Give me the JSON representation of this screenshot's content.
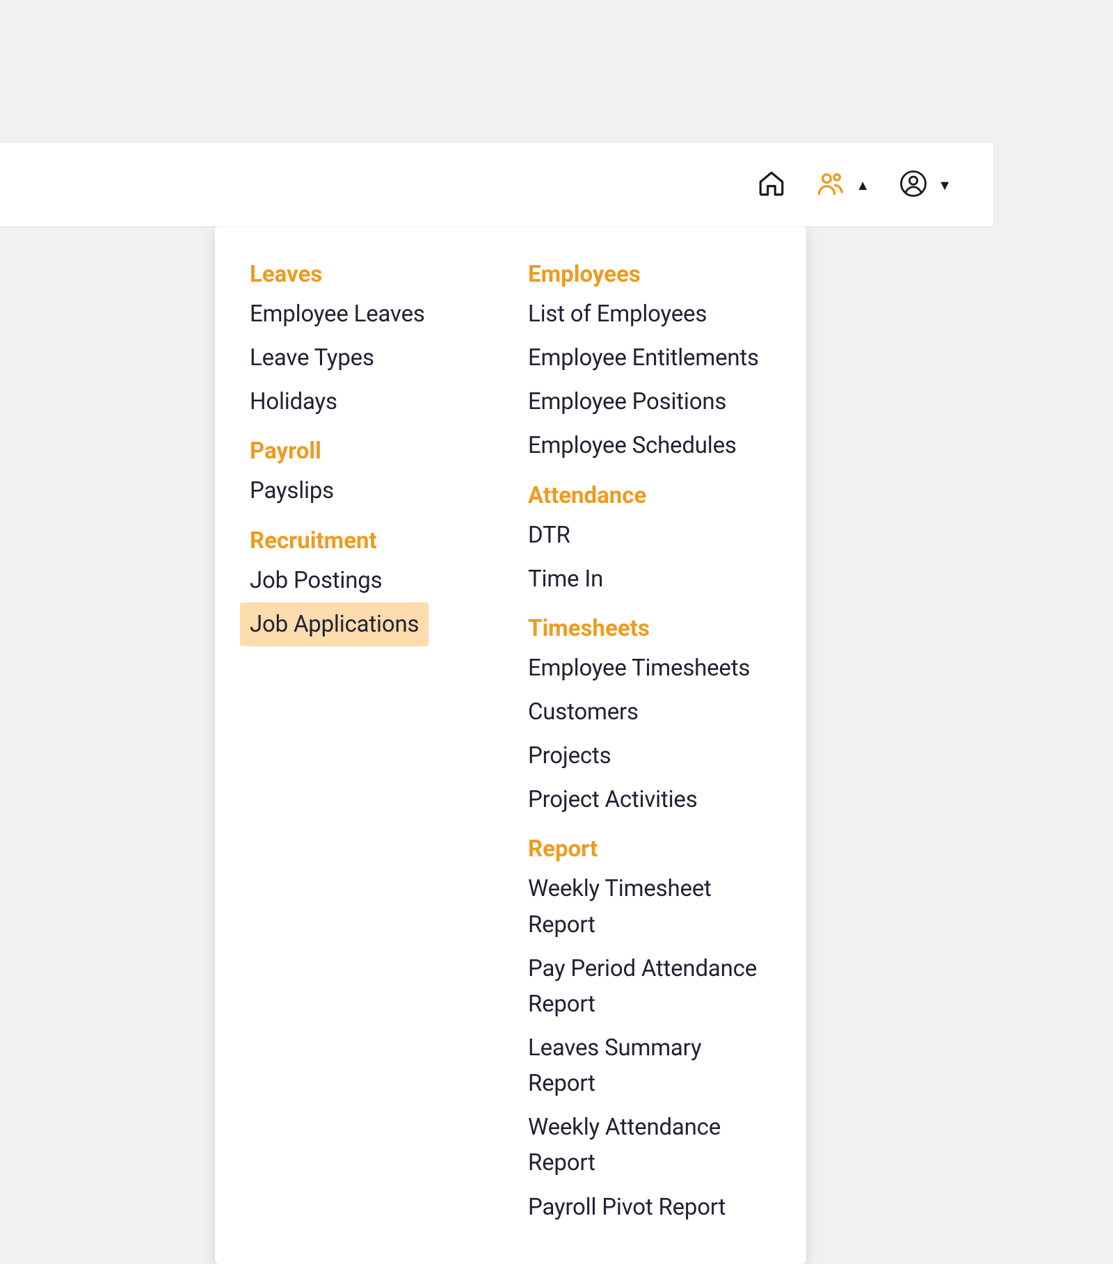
{
  "colors": {
    "accent": "#ee9b1f",
    "highlight_bg": "#fddcad",
    "text": "#1e2233",
    "page_bg": "#f1f1f1"
  },
  "topbar": {
    "home_icon": "home-icon",
    "people_icon": "people-icon",
    "profile_icon": "profile-icon",
    "people_caret": "up",
    "profile_caret": "down"
  },
  "menu": {
    "left_column": [
      {
        "header": "Leaves",
        "items": [
          {
            "label": "Employee Leaves",
            "highlighted": false
          },
          {
            "label": "Leave Types",
            "highlighted": false
          },
          {
            "label": "Holidays",
            "highlighted": false
          }
        ]
      },
      {
        "header": "Payroll",
        "items": [
          {
            "label": "Payslips",
            "highlighted": false
          }
        ]
      },
      {
        "header": "Recruitment",
        "items": [
          {
            "label": "Job Postings",
            "highlighted": false
          },
          {
            "label": "Job Applications",
            "highlighted": true
          }
        ]
      }
    ],
    "right_column": [
      {
        "header": "Employees",
        "items": [
          {
            "label": "List of Employees",
            "highlighted": false
          },
          {
            "label": "Employee Entitlements",
            "highlighted": false
          },
          {
            "label": "Employee Positions",
            "highlighted": false
          },
          {
            "label": "Employee Schedules",
            "highlighted": false
          }
        ]
      },
      {
        "header": "Attendance",
        "items": [
          {
            "label": "DTR",
            "highlighted": false
          },
          {
            "label": "Time In",
            "highlighted": false
          }
        ]
      },
      {
        "header": "Timesheets",
        "items": [
          {
            "label": "Employee Timesheets",
            "highlighted": false
          },
          {
            "label": "Customers",
            "highlighted": false
          },
          {
            "label": "Projects",
            "highlighted": false
          },
          {
            "label": "Project Activities",
            "highlighted": false
          }
        ]
      },
      {
        "header": "Report",
        "items": [
          {
            "label": "Weekly Timesheet Report",
            "highlighted": false
          },
          {
            "label": "Pay Period Attendance Report",
            "highlighted": false
          },
          {
            "label": "Leaves Summary Report",
            "highlighted": false
          },
          {
            "label": "Weekly Attendance Report",
            "highlighted": false
          },
          {
            "label": "Payroll Pivot Report",
            "highlighted": false
          }
        ]
      }
    ]
  }
}
